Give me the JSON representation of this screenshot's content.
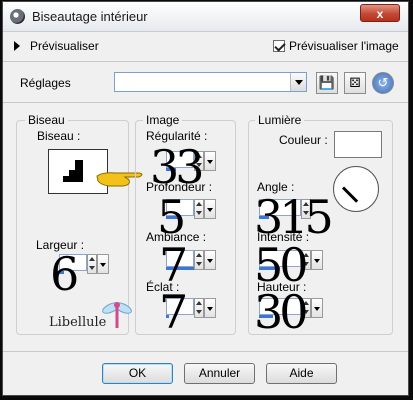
{
  "window": {
    "title": "Biseautage intérieur",
    "close_glyph": "x"
  },
  "preview": {
    "label": "Prévisualiser",
    "check_label": "Prévisualiser l'image",
    "checked": true
  },
  "presets": {
    "label": "Réglages",
    "value": ""
  },
  "groups": {
    "bevel": {
      "title": "Biseau",
      "bevel_label": "Biseau :",
      "width_label": "Largeur :",
      "width_value": "6"
    },
    "image": {
      "title": "Image",
      "smoothness_label": "Régularité :",
      "smoothness_value": "33",
      "depth_label": "Profondeur :",
      "depth_value": "5",
      "ambience_label": "Ambiance :",
      "ambience_value": "7",
      "shininess_label": "Éclat :",
      "shininess_value": "7"
    },
    "light": {
      "title": "Lumière",
      "color_label": "Couleur :",
      "color_value": "#ffffff",
      "angle_label": "Angle :",
      "angle_value": "315",
      "intensity_label": "Intensité :",
      "intensity_value": "50",
      "elevation_label": "Hauteur :",
      "elevation_value": "30"
    }
  },
  "buttons": {
    "ok": "OK",
    "cancel": "Annuler",
    "help": "Aide"
  },
  "watermark": {
    "text": "Libellule"
  },
  "icons": [
    "app-icon",
    "preview-arrow-icon",
    "save-preset-icon",
    "random-dice-icon",
    "reset-icon",
    "pointing-hand-icon",
    "dragonfly-icon"
  ],
  "colors": {
    "accent": "#3a78d8",
    "hand": "#f3c21a"
  }
}
